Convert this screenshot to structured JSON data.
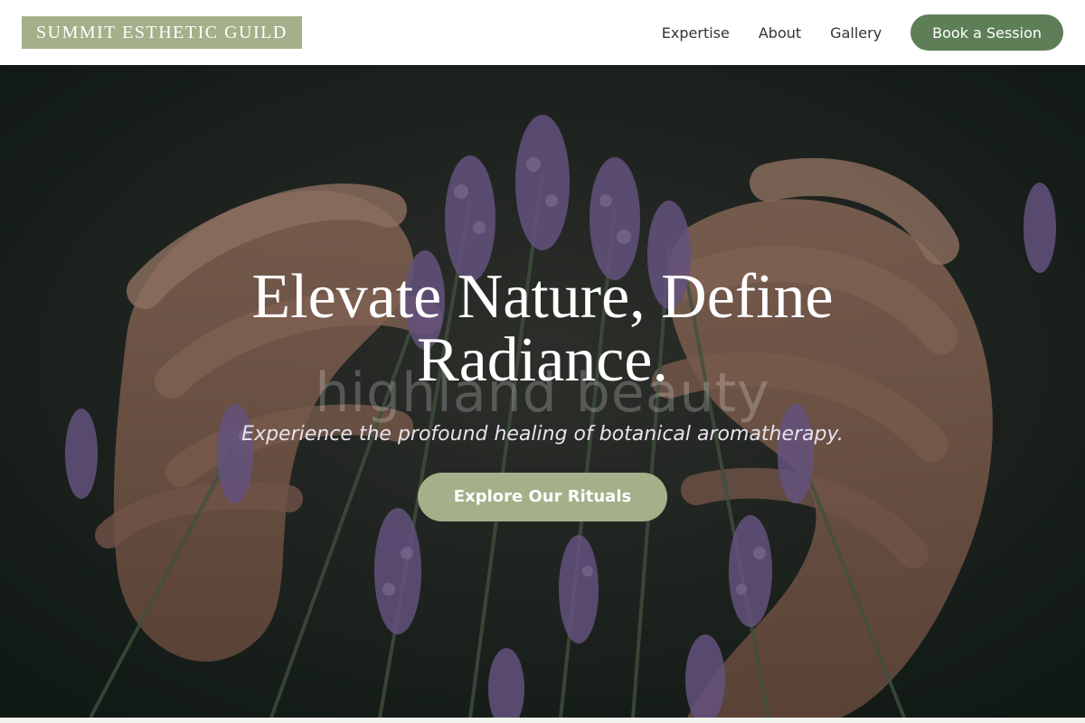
{
  "brand": {
    "logo_text": "SUMMIT ESTHETIC GUILD",
    "accent": "#a3b08a",
    "button_green": "#5e7e58"
  },
  "nav": {
    "links": [
      {
        "label": "Expertise"
      },
      {
        "label": "About"
      },
      {
        "label": "Gallery"
      }
    ],
    "cta_label": "Book a Session"
  },
  "hero": {
    "title_line1": "Elevate Nature, Define",
    "title_line2": "Radiance.",
    "watermark": "highland beauty",
    "subtitle": "Experience the profound healing of botanical aromatherapy.",
    "cta_label": "Explore Our Rituals",
    "background_image": "hands cradling lavender flowers"
  }
}
